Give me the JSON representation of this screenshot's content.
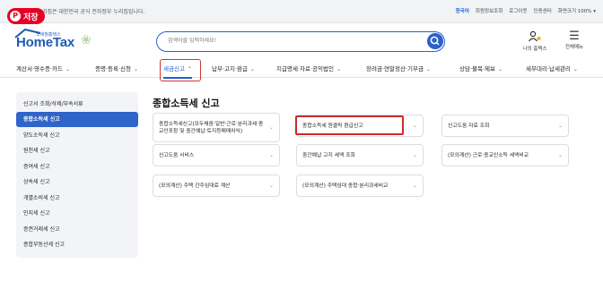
{
  "pin": {
    "label": "저장"
  },
  "topbar": {
    "notice": "이 누리집은 대한민국 공식 전자정부 누리집입니다.",
    "links": [
      "한국어",
      "회원정보조회",
      "로그아웃",
      "인증센터",
      "화면크기 100% ▾"
    ]
  },
  "header": {
    "logo_sub": "국세청홈택스",
    "logo": "HomeTax",
    "search_placeholder": "검색어를 입력하세요!",
    "icons": [
      {
        "name": "person-bell-icon",
        "label": "나의 홈택스"
      },
      {
        "name": "menu-icon",
        "label": "전체메뉴"
      }
    ]
  },
  "nav": {
    "items": [
      "계산서·영수증·카드",
      "증명·등록·신청",
      "세금신고",
      "납부·고지·환급",
      "지급명세·자료·공익법인",
      "장려금·연말정산·기부금",
      "상담·불복·제보",
      "세무대리·납세관리"
    ],
    "active": 2
  },
  "sidebar": {
    "items": [
      "신고서 조회/삭제/부속서류",
      "종합소득세 신고",
      "양도소득세 신고",
      "원천세 신고",
      "증여세 신고",
      "상속세 신고",
      "개별소비세 신고",
      "인지세 신고",
      "증권거래세 신고",
      "종합부동산세 신고"
    ],
    "active": 1
  },
  "main": {
    "title": "종합소득세 신고",
    "cards": [
      "종합소득세신고(모두채움·일반·근로·분리과세·종교인포함 및 중간예납·토지등매매차익)",
      "종합소득세 원클릭 환급신고",
      "신고도움 자료 조회",
      "신고도움 서비스",
      "중간예납 고지 세액 조회",
      "(모의계산) 근로·종교인소득 세액비교",
      "(모의계산) 주택 간주임대료 계산",
      "(모의계산) 주택임대 종합·분리과세비교"
    ]
  },
  "colors": {
    "accent": "#2f64c8",
    "highlight": "#cc2b2b",
    "pin": "#e60023"
  }
}
